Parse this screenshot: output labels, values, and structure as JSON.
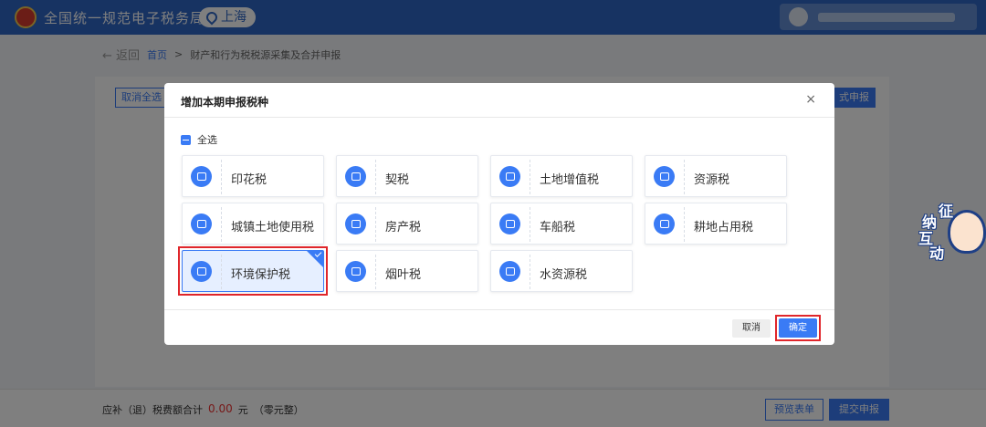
{
  "header": {
    "title": "全国统一规范电子税务局",
    "region": "上海"
  },
  "breadcrumb": {
    "back": "返回",
    "home": "首页",
    "separator": ">",
    "current": "财产和行为税税源采集及合并申报"
  },
  "background": {
    "cancel_all_label": "取消全选",
    "formal_report_label": "式申报"
  },
  "bottom": {
    "label": "应补（退）税费额合计",
    "amount": "0.00",
    "unit": "元",
    "amount_words": "（零元整）",
    "preview_label": "预览表单",
    "submit_label": "提交申报"
  },
  "modal": {
    "title": "增加本期申报税种",
    "close_icon": "close-icon",
    "select_all_label": "全选",
    "tiles": [
      {
        "name": "印花税",
        "icon": "document-icon",
        "selected": false
      },
      {
        "name": "契税",
        "icon": "contract-icon",
        "selected": false
      },
      {
        "name": "土地增值税",
        "icon": "land-icon",
        "selected": false
      },
      {
        "name": "资源税",
        "icon": "resource-icon",
        "selected": false
      },
      {
        "name": "城镇土地使用税",
        "icon": "building-icon",
        "selected": false
      },
      {
        "name": "房产税",
        "icon": "house-icon",
        "selected": false
      },
      {
        "name": "车船税",
        "icon": "vehicle-icon",
        "selected": false
      },
      {
        "name": "耕地占用税",
        "icon": "farmland-icon",
        "selected": false
      },
      {
        "name": "环境保护税",
        "icon": "environment-icon",
        "selected": true
      },
      {
        "name": "烟叶税",
        "icon": "tobacco-icon",
        "selected": false
      },
      {
        "name": "水资源税",
        "icon": "water-icon",
        "selected": false
      }
    ],
    "cancel_label": "取消",
    "confirm_label": "确定"
  },
  "mascot": {
    "chars": [
      "征",
      "纳",
      "互",
      "动"
    ]
  },
  "colors": {
    "brand": "#2f66c5",
    "accent": "#3a7bf5",
    "highlight": "#e0262b"
  }
}
